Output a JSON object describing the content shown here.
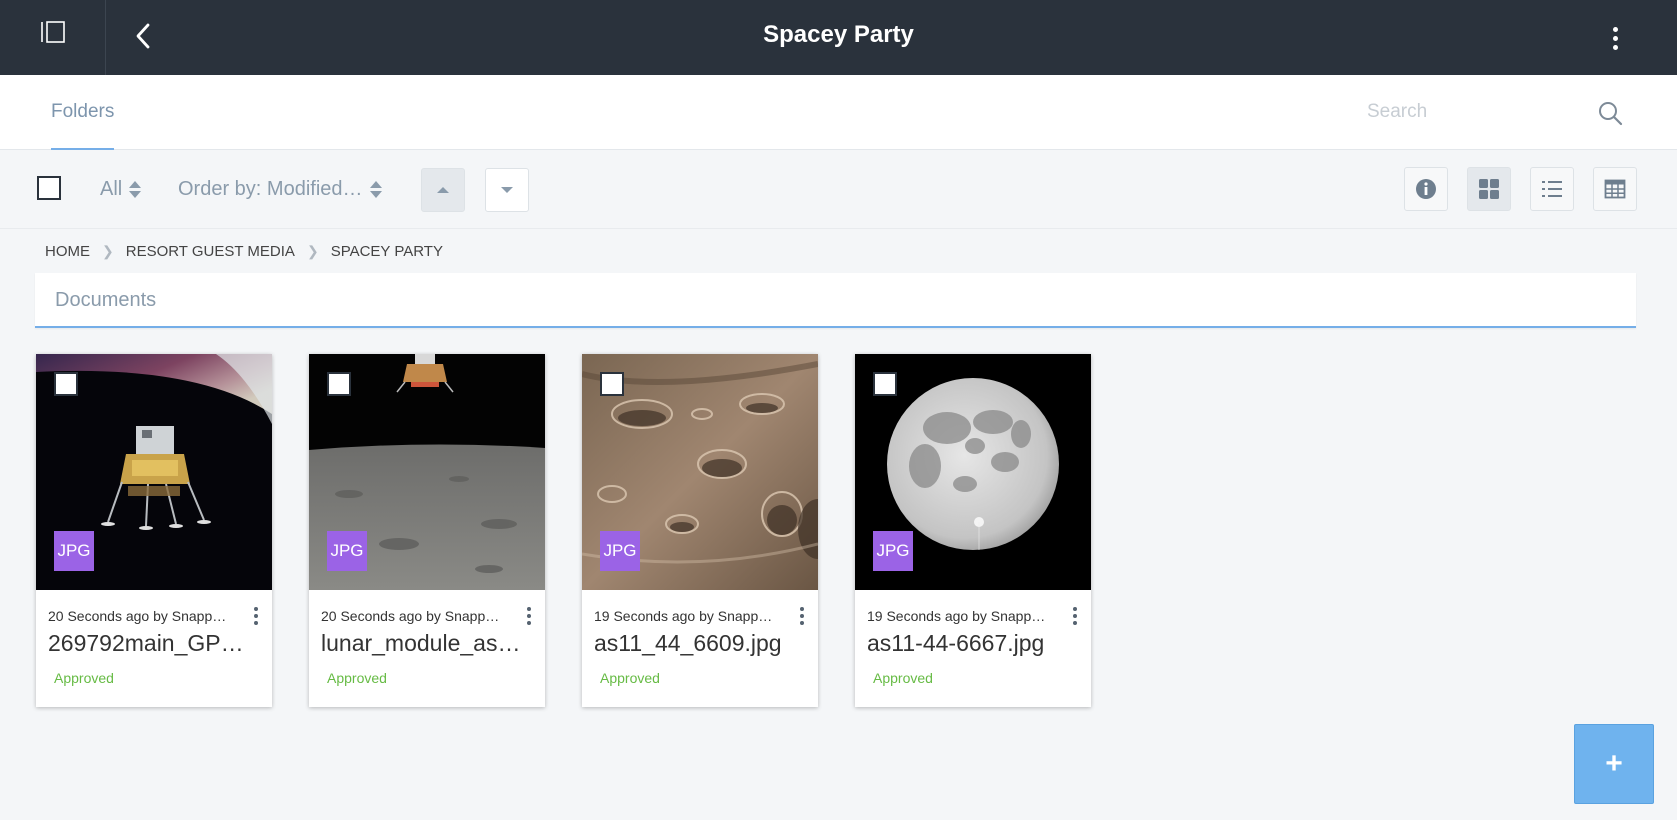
{
  "header": {
    "title": "Spacey Party"
  },
  "tabs": {
    "folders_label": "Folders"
  },
  "search": {
    "placeholder": "Search",
    "value": ""
  },
  "toolbar": {
    "filter_label": "All",
    "order_label": "Order by: Modified…"
  },
  "breadcrumb": [
    "HOME",
    "RESORT GUEST MEDIA",
    "SPACEY PARTY"
  ],
  "section": {
    "title": "Documents"
  },
  "documents": [
    {
      "meta": "20 Seconds ago by Snappy …",
      "name": "269792main_GP…",
      "type": "JPG",
      "status": "Approved"
    },
    {
      "meta": "20 Seconds ago by Snappy …",
      "name": "lunar_module_as…",
      "type": "JPG",
      "status": "Approved"
    },
    {
      "meta": "19 Seconds ago by Snappy …",
      "name": "as11_44_6609.jpg",
      "type": "JPG",
      "status": "Approved"
    },
    {
      "meta": "19 Seconds ago by Snappy …",
      "name": "as11-44-6667.jpg",
      "type": "JPG",
      "status": "Approved"
    }
  ],
  "fab": {
    "label": "+"
  },
  "colors": {
    "topbar": "#2a323c",
    "accent": "#75aee8",
    "file_badge": "#9b63e6",
    "approved": "#66bb44",
    "fab": "#6fb3ee"
  },
  "icons": {
    "sidebar_toggle": "sidebar-toggle-icon",
    "back": "chevron-left-icon",
    "more": "kebab-vertical-icon",
    "search": "search-icon",
    "sort_asc": "caret-up-icon",
    "sort_desc": "caret-down-icon",
    "info": "info-icon",
    "grid_view": "grid-view-icon",
    "list_view": "list-view-icon",
    "table_view": "table-view-icon"
  }
}
